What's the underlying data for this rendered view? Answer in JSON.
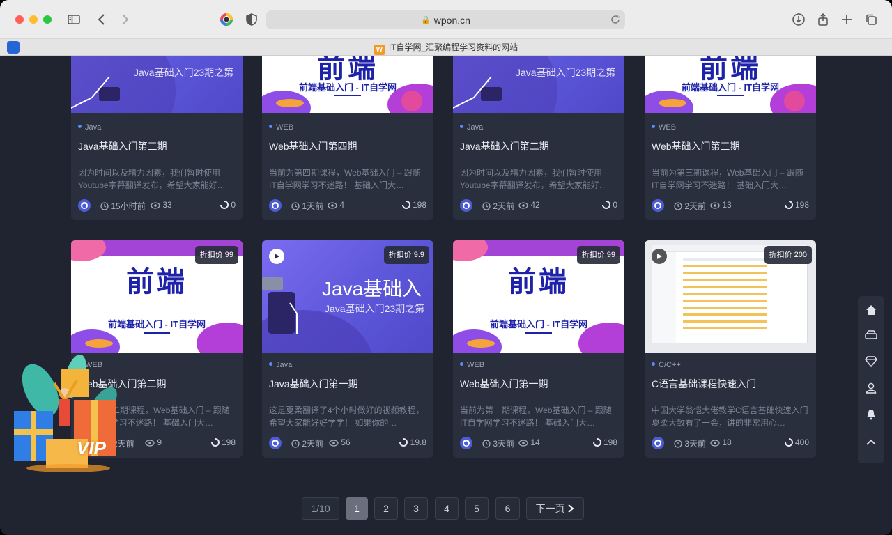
{
  "browser": {
    "url": "wpon.cn",
    "tab_title": "IT自学网_汇聚编程学习资料的网站",
    "tab_logo_letter": "W",
    "left_tab_glyph": "🐾"
  },
  "cards": [
    {
      "category": "Java",
      "title": "Java基础入门第三期",
      "desc": "因为时间以及精力因素，我们暂时使用Youtube字幕翻译发布，希望大家能好…",
      "time": "15小时前",
      "views": "33",
      "score": "0",
      "thumb_text": "Java基础入门23期之第"
    },
    {
      "category": "WEB",
      "title": "Web基础入门第四期",
      "desc": "当前为第四期课程，Web基础入门 – 跟随IT自学网学习不迷路！ 基础入门大…",
      "time": "1天前",
      "views": "4",
      "score": "198",
      "thumb_big": "前端",
      "thumb_sub": "前端基础入门 - IT自学网"
    },
    {
      "category": "Java",
      "title": "Java基础入门第二期",
      "desc": "因为时间以及精力因素，我们暂时使用Youtube字幕翻译发布，希望大家能好…",
      "time": "2天前",
      "views": "42",
      "score": "0",
      "thumb_text": "Java基础入门23期之第"
    },
    {
      "category": "WEB",
      "title": "Web基础入门第三期",
      "desc": "当前为第三期课程，Web基础入门 – 跟随IT自学网学习不迷路！ 基础入门大…",
      "time": "2天前",
      "views": "13",
      "score": "198",
      "thumb_big": "前端",
      "thumb_sub": "前端基础入门 - IT自学网"
    },
    {
      "category": "WEB",
      "title": "Web基础入门第二期",
      "desc": "当前为第二期课程，Web基础入门 – 跟随IT自学网学习不迷路！ 基础入门大…",
      "time": "2天前",
      "views": "9",
      "score": "198",
      "price": "折扣价 99",
      "thumb_big": "前端",
      "thumb_sub": "前端基础入门 - IT自学网"
    },
    {
      "category": "Java",
      "title": "Java基础入门第一期",
      "desc": "这是夏柔翻译了4个小时做好的视频教程，希望大家能好好学学！ 如果你的…",
      "time": "2天前",
      "views": "56",
      "score": "19.8",
      "price": "折扣价 9.9",
      "thumb_big": "Java基础入",
      "thumb_text": "Java基础入门23期之第"
    },
    {
      "category": "WEB",
      "title": "Web基础入门第一期",
      "desc": "当前为第一期课程，Web基础入门 – 跟随IT自学网学习不迷路！ 基础入门大…",
      "time": "3天前",
      "views": "14",
      "score": "198",
      "price": "折扣价 99",
      "thumb_big": "前端",
      "thumb_sub": "前端基础入门 - IT自学网"
    },
    {
      "category": "C/C++",
      "title": "C语言基础课程快速入门",
      "desc": "中国大学翁恺大佬教学C语言基础快速入门 夏柔大致看了一会，讲的非常用心…",
      "time": "3天前",
      "views": "18",
      "score": "400",
      "price": "折扣价 200"
    }
  ],
  "pagination": {
    "info": "1/10",
    "pages": [
      "1",
      "2",
      "3",
      "4",
      "5",
      "6"
    ],
    "active": "1",
    "next": "下一页"
  },
  "vip_label": "VIP",
  "colors": {
    "page_bg": "#1f2430",
    "card_bg": "#2a2f3d",
    "accent_dot": "#5b8cf5",
    "web_title": "#1d22a8"
  },
  "sidebar_icons": [
    "home-icon",
    "car-icon",
    "diamond-icon",
    "user-icon",
    "bell-icon",
    "chevron-up-icon"
  ]
}
